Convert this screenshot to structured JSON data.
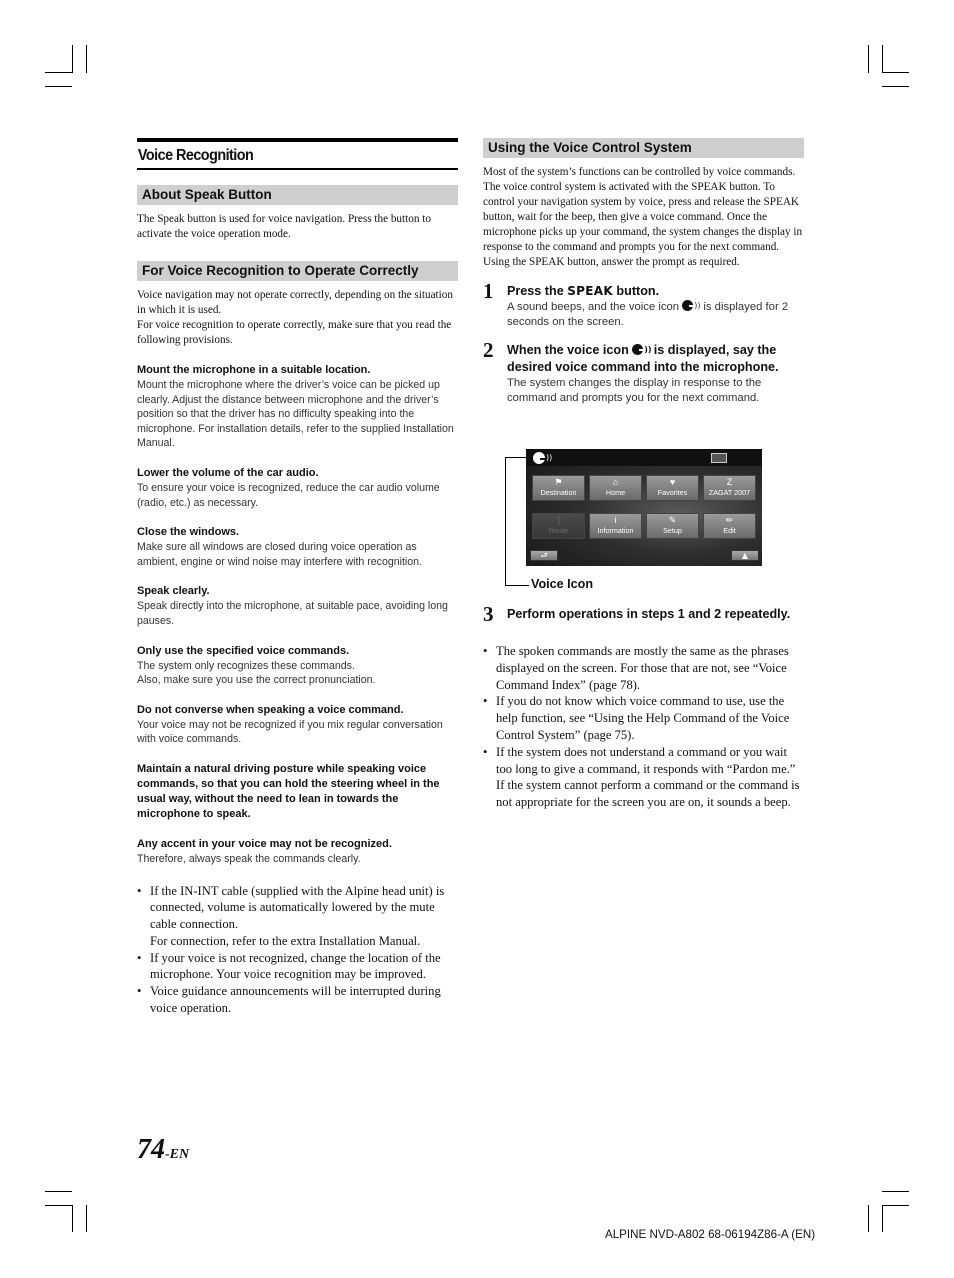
{
  "left_column": {
    "main_title": "Voice Recognition",
    "about_speak": {
      "heading": "About Speak Button",
      "body": "The Speak button is used for voice navigation. Press the button to activate the voice operation mode."
    },
    "operate_correctly": {
      "heading": "For Voice Recognition to Operate Correctly",
      "intro_1": "Voice navigation may not operate correctly, depending on the situation in which it is used.",
      "intro_2": "For voice recognition to operate correctly, make sure that you read the following provisions.",
      "provisions": [
        {
          "title": "Mount the microphone in a suitable location.",
          "body": "Mount the microphone where the driver’s voice can be picked up clearly. Adjust the distance between microphone and the driver’s position so that the driver has no difficulty speaking into the microphone. For installation details, refer to the supplied Installation Manual."
        },
        {
          "title": "Lower the volume of the car audio.",
          "body": "To ensure your voice is recognized, reduce the car audio volume (radio, etc.) as necessary."
        },
        {
          "title": "Close the windows.",
          "body": "Make sure all windows are closed during voice operation as ambient, engine or wind noise may interfere with recognition."
        },
        {
          "title": "Speak clearly.",
          "body": "Speak directly into the microphone, at suitable pace, avoiding long pauses."
        },
        {
          "title": "Only use the specified voice commands.",
          "body": "The system only recognizes these commands.",
          "body_2": "Also, make sure you use the correct pronunciation."
        },
        {
          "title": "Do not converse when speaking a voice command.",
          "body": "Your voice may not be recognized if you mix regular conversation with voice commands."
        },
        {
          "title": "Maintain a natural driving posture while speaking voice commands, so that you can hold the steering wheel in the usual way, without the need to lean in towards the microphone to speak."
        },
        {
          "title": "Any accent in your voice may not be recognized.",
          "body": "Therefore, always speak the commands clearly."
        }
      ]
    },
    "bullets": [
      {
        "text": "If the IN-INT cable (supplied with the Alpine head unit) is connected, volume is automatically lowered by the mute cable connection.",
        "extra": "For connection, refer to the extra Installation Manual."
      },
      {
        "text": "If your voice is not recognized, change the location of the microphone. Your voice recognition may be improved."
      },
      {
        "text": "Voice guidance announcements will be interrupted during voice operation."
      }
    ],
    "bullet_char": "•"
  },
  "right_column": {
    "heading": "Using the Voice Control System",
    "intro": "Most of the system’s functions can be controlled by voice commands. The voice control system is activated with the SPEAK button. To control your navigation system by voice, press and release the SPEAK button, wait for the beep, then give a voice command. Once the microphone picks up your command, the system changes the display in response to the command and prompts you for the next command. Using the SPEAK button, answer the prompt as required.",
    "steps": [
      {
        "number": "1",
        "title_pre": "Press the ",
        "title_key": "SPEAK",
        "title_post": " button.",
        "body_pre": "A sound beeps, and the voice icon ",
        "body_post": " is displayed for 2 seconds on the screen."
      },
      {
        "number": "2",
        "title_pre": "When the voice icon ",
        "title_post": " is displayed, say the desired voice command into the microphone.",
        "body": "The system changes the display in response to the command and prompts you for the next command."
      },
      {
        "number": "3",
        "title": "Perform operations in steps 1 and 2 repeatedly."
      }
    ],
    "screen": {
      "callout_label": "Voice Icon",
      "wave_glyph": "))",
      "buttons": [
        {
          "label": "Destination",
          "icon": "⚑",
          "enabled": true
        },
        {
          "label": "Home",
          "icon": "⌂",
          "enabled": true
        },
        {
          "label": "Favorites",
          "icon": "♥",
          "enabled": true
        },
        {
          "label": "ZAGAT 2007",
          "icon": "Z",
          "enabled": true
        },
        {
          "label": "Route",
          "icon": "⟆",
          "enabled": false
        },
        {
          "label": "Information",
          "icon": "i",
          "enabled": true
        },
        {
          "label": "Setup",
          "icon": "✎",
          "enabled": true
        },
        {
          "label": "Edit",
          "icon": "✏",
          "enabled": true
        }
      ],
      "back_glyph": "⮐",
      "up_glyph": "▲"
    },
    "bullets": [
      {
        "text": "The spoken commands are mostly the same as the phrases displayed on the screen. For those that are not, see “Voice Command Index” (page 78)."
      },
      {
        "text": "If you do not know which voice command to use, use the help function, see “Using the Help Command of the Voice Control System” (page 75)."
      },
      {
        "text": "If the system does not understand a command or you wait too long to give a command, it responds with “Pardon me.” If the system cannot perform a command or the command is not appropriate for the screen you are on, it sounds a beep."
      }
    ]
  },
  "footer": {
    "page_number": "74",
    "page_suffix": "-EN",
    "document_code": "ALPINE NVD-A802 68-06194Z86-A (EN)"
  }
}
